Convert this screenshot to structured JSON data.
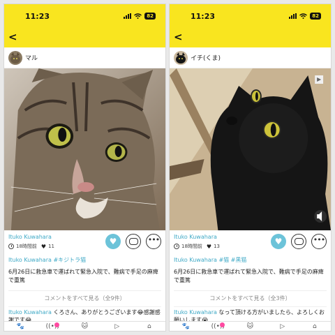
{
  "colors": {
    "header_yellow": "#f9e51f",
    "link_blue": "#3fa9c6",
    "like_button": "#6cc3d9",
    "badge_pink": "#ff4aa1"
  },
  "panels": [
    {
      "status": {
        "time": "11:23",
        "battery": "82"
      },
      "user": {
        "name": "マル"
      },
      "author": "Ituko Kuwahara",
      "time_ago": "18時間前",
      "likes": "11",
      "tag_author": "Ituko Kuwahara",
      "tags": "#キジトラ猫",
      "caption": "6月26日に救急車で運ばれて緊急入院で、難病で手足の麻痺で重篤",
      "view_comments": "コメントをすべて見る（全9件）",
      "comment_author": "Ituko Kuwahara",
      "comment_text": " くろさん、ありがとうございます😂感謝感謝です😂"
    },
    {
      "status": {
        "time": "11:23",
        "battery": "82"
      },
      "user": {
        "name": "イチ(くま)"
      },
      "author": "Ituko Kuwahara",
      "time_ago": "18時間前",
      "likes": "13",
      "tag_author": "Ituko Kuwahara",
      "tags": "#猫 #黒猫",
      "caption": "6月26日に救急車で運ばれて緊急入院で、難病で手足の麻痺で重篤",
      "view_comments": "コメントをすべて見る（全3件）",
      "comment_author": "Ituko Kuwahara",
      "comment_text": " なって頂ける方がいましたら、よろしくお願いします😭"
    }
  ],
  "icons": {
    "back": "chevron-left-icon",
    "like": "heart-icon",
    "comment": "comment-bubble-icon",
    "more": "ellipsis-icon",
    "sound": "speaker-icon",
    "tabs": [
      "paw-icon",
      "broadcast-icon",
      "cat-face-icon",
      "play-icon",
      "house-icon"
    ]
  }
}
